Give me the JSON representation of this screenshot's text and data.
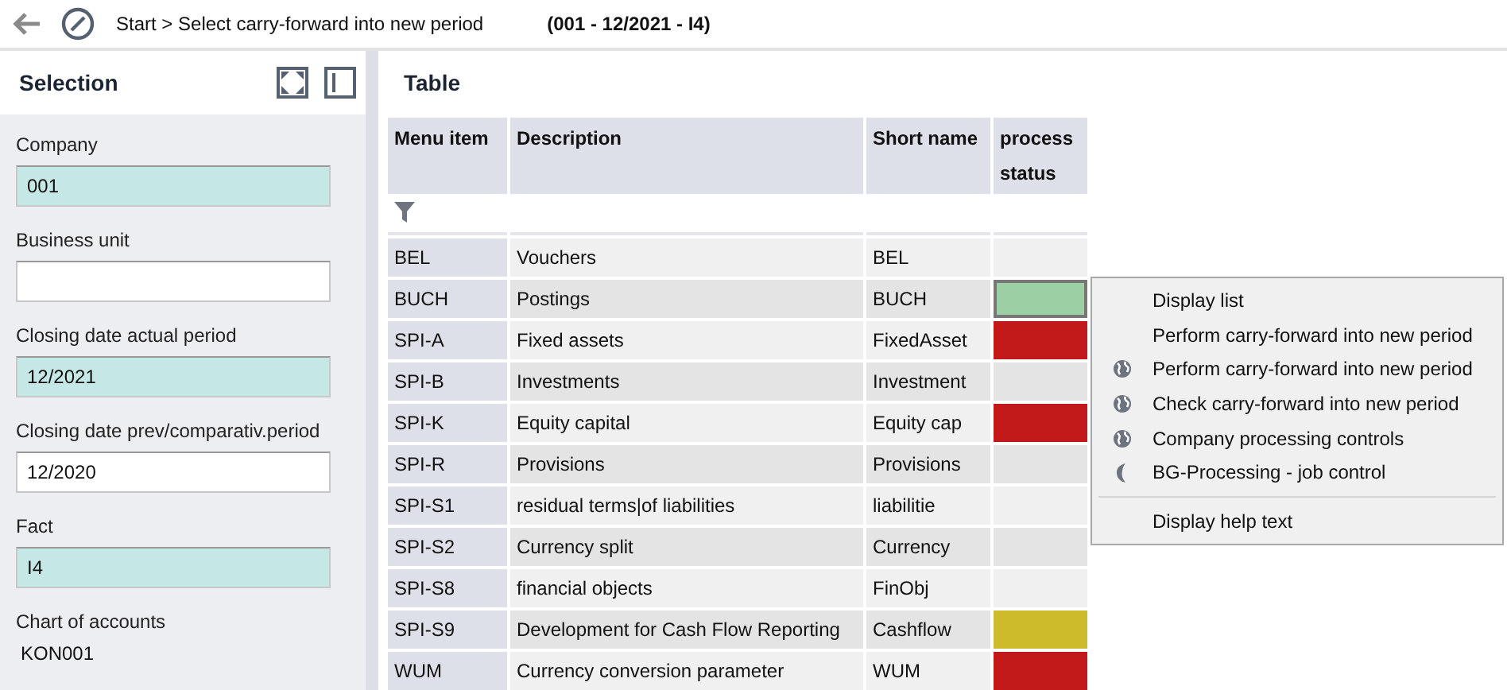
{
  "toolbar": {
    "breadcrumb": "Start > Select carry-forward into new period",
    "context": "(001 - 12/2021 - I4)"
  },
  "selection": {
    "title": "Selection",
    "fields": [
      {
        "label": "Company",
        "value": "001",
        "kind": "field",
        "mandatory": true
      },
      {
        "label": "Business unit",
        "kind": "field",
        "mandatory": false
      },
      {
        "label": "Closing date actual period",
        "value": "12/2021",
        "kind": "field",
        "mandatory": true
      },
      {
        "label": "Closing date prev/comparativ.period",
        "value": "12/2020",
        "kind": "field",
        "mandatory": false
      },
      {
        "label": "Fact",
        "value": "I4",
        "kind": "field",
        "mandatory": true
      },
      {
        "label": "Chart of accounts",
        "value": "KON001",
        "kind": "display"
      }
    ]
  },
  "table": {
    "title": "Table",
    "columns": [
      "Menu item",
      "Description",
      "Short name",
      "process status"
    ],
    "rows": [
      {
        "cells": [
          "BEL",
          "Vouchers",
          "BEL"
        ],
        "selected": false
      },
      {
        "cells": [
          "BUCH",
          "Postings",
          "BUCH"
        ],
        "selected": true,
        "color": "#9ccfa3"
      },
      {
        "cells": [
          "SPI-A",
          "Fixed assets",
          "FixedAsset"
        ],
        "selected": false,
        "color": "#c21a1a"
      },
      {
        "cells": [
          "SPI-B",
          "Investments",
          "Investment"
        ],
        "selected": false
      },
      {
        "cells": [
          "SPI-K",
          "Equity capital",
          "Equity cap"
        ],
        "selected": false,
        "color": "#c21a1a"
      },
      {
        "cells": [
          "SPI-R",
          "Provisions",
          "Provisions"
        ],
        "selected": false
      },
      {
        "cells": [
          "SPI-S1",
          "residual terms|of liabilities",
          "liabilitie"
        ],
        "selected": false
      },
      {
        "cells": [
          "SPI-S2",
          "Currency split",
          "Currency"
        ],
        "selected": false
      },
      {
        "cells": [
          "SPI-S8",
          "financial objects",
          "FinObj"
        ],
        "selected": false
      },
      {
        "cells": [
          "SPI-S9",
          "Development for Cash Flow Reporting",
          "Cashflow"
        ],
        "selected": false,
        "color": "#cdbb2b"
      },
      {
        "cells": [
          "WUM",
          "Currency conversion parameter",
          "WUM"
        ],
        "selected": false,
        "color": "#c21a1a"
      }
    ]
  },
  "context_menu": {
    "sections": [
      [
        {
          "label": "Display list",
          "kind": "plain"
        },
        {
          "label": "Perform carry-forward into new period",
          "kind": "plain"
        },
        {
          "label": "Perform carry-forward into new period",
          "kind": "web"
        },
        {
          "label": "Check carry-forward into new period",
          "kind": "web"
        },
        {
          "label": "Company processing controls",
          "kind": "web"
        },
        {
          "label": "BG-Processing - job control",
          "kind": "background"
        }
      ],
      [
        {
          "label": "Display help text",
          "kind": "plain"
        }
      ]
    ]
  }
}
